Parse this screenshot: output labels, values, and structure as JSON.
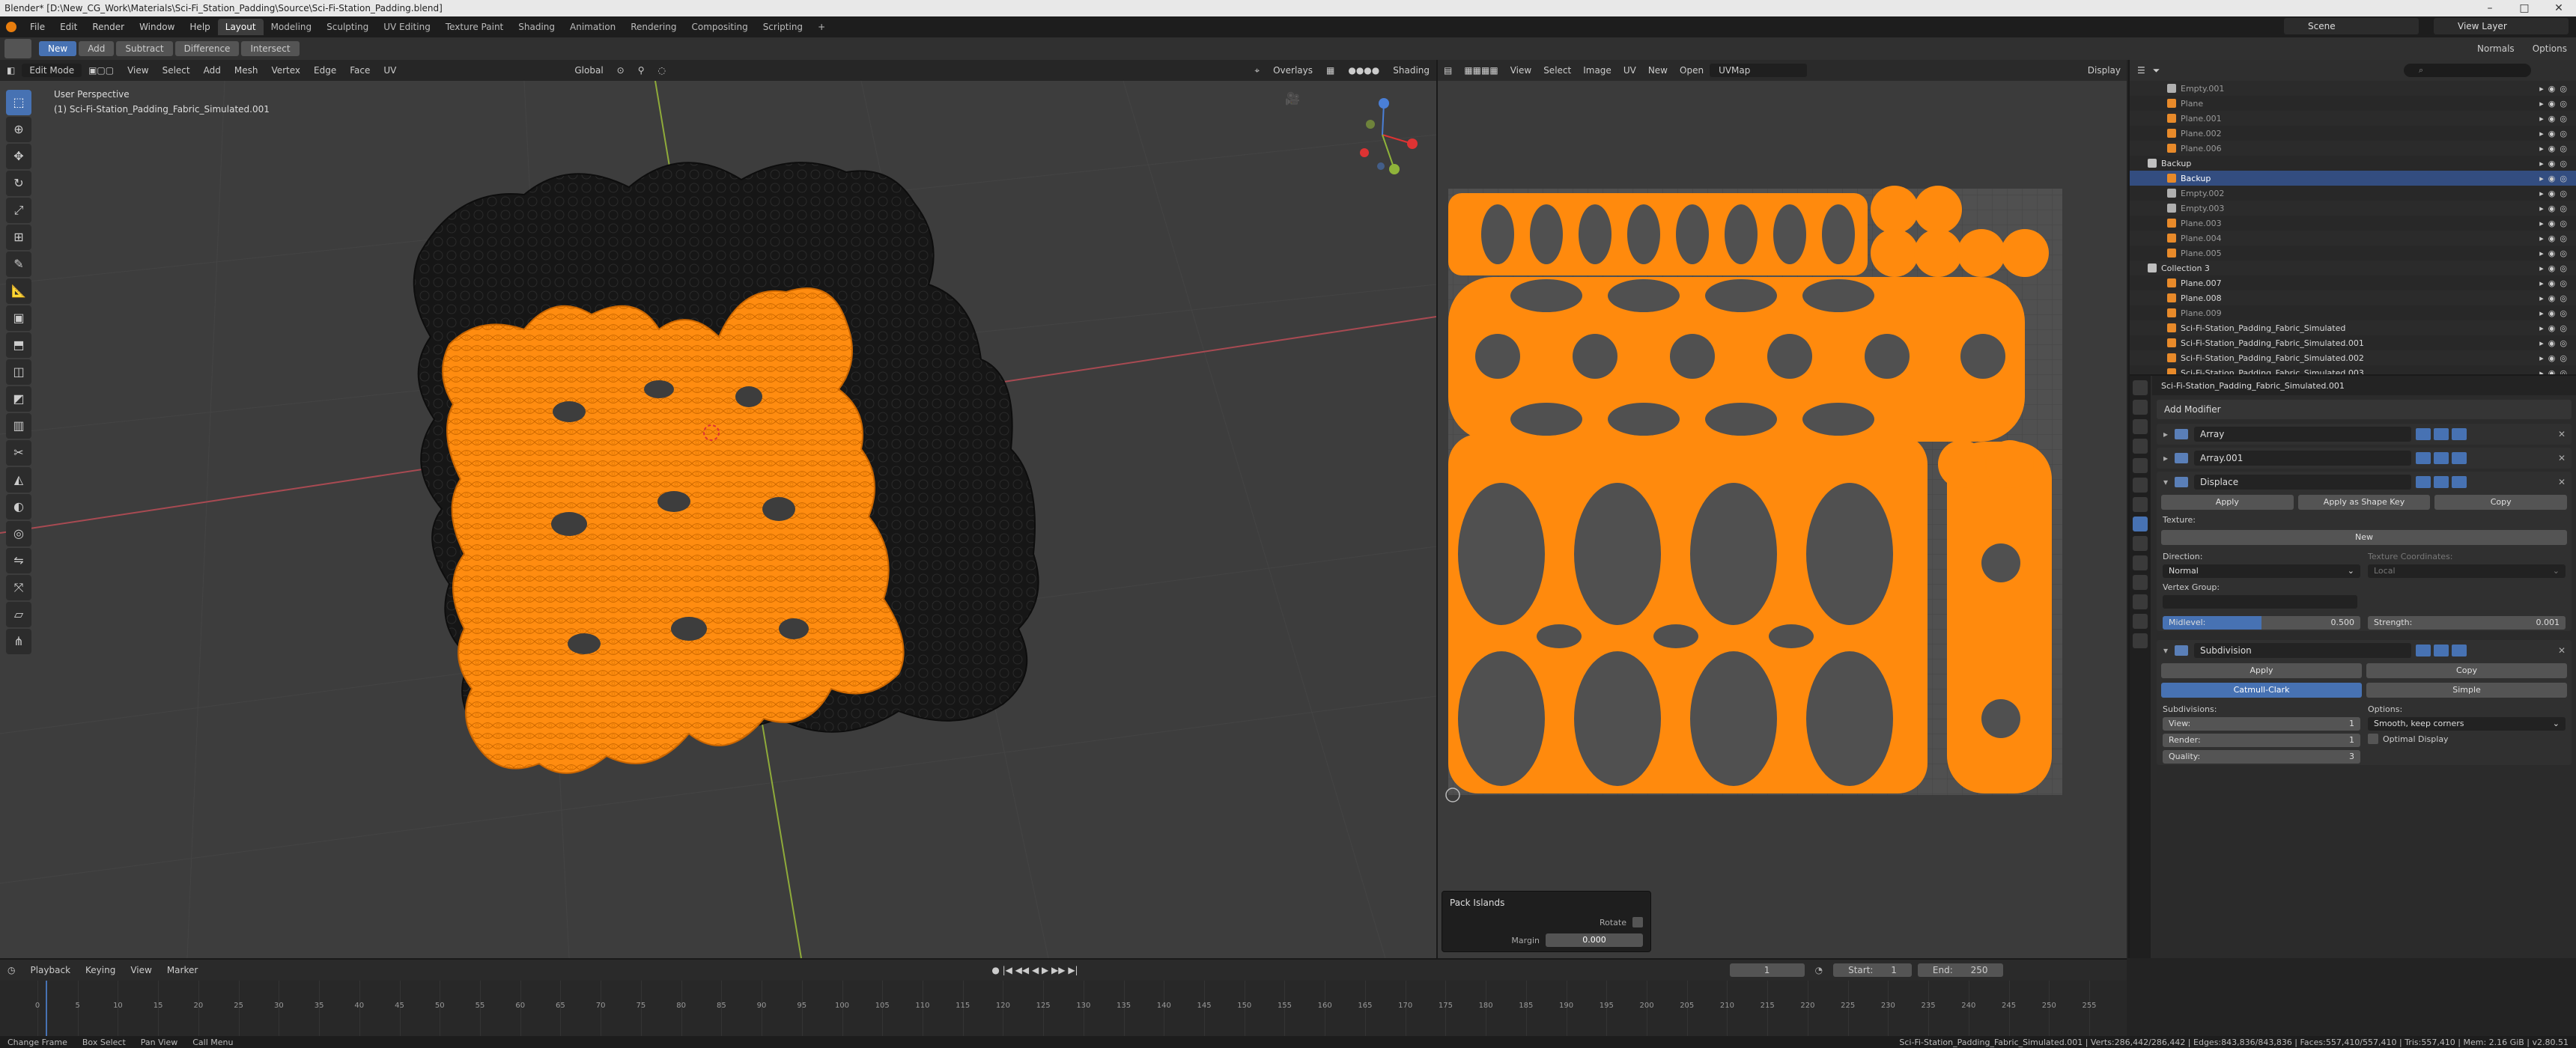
{
  "window": {
    "title": "Blender* [D:\\New_CG_Work\\Materials\\Sci-Fi_Station_Padding\\Source\\Sci-Fi-Station_Padding.blend]",
    "controls": [
      "–",
      "□",
      "✕"
    ]
  },
  "menu": [
    "File",
    "Edit",
    "Render",
    "Window",
    "Help"
  ],
  "workspaces": [
    "Layout",
    "Modeling",
    "Sculpting",
    "UV Editing",
    "Texture Paint",
    "Shading",
    "Animation",
    "Rendering",
    "Compositing",
    "Scripting",
    "+"
  ],
  "scene": {
    "scene_name": "Scene",
    "view_layer": "View Layer"
  },
  "tool_header": {
    "buttons": [
      "New",
      "Add",
      "Subtract",
      "Difference",
      "Intersect"
    ],
    "right": [
      "Normals",
      "Options"
    ]
  },
  "viewport": {
    "mode": "Edit Mode",
    "menus": [
      "View",
      "Select",
      "Add",
      "Mesh",
      "Vertex",
      "Edge",
      "Face",
      "UV"
    ],
    "orientation": "Global",
    "overlays": "Overlays",
    "shading": "Shading",
    "info_line1": "User Perspective",
    "info_line2": "(1) Sci-Fi-Station_Padding_Fabric_Simulated.001"
  },
  "uv_editor": {
    "menus": [
      "View",
      "Select",
      "Image",
      "UV"
    ],
    "new_label": "New",
    "open_label": "Open",
    "uvmap": "UVMap",
    "display": "Display",
    "pack_panel": {
      "title": "Pack Islands",
      "rotate_label": "Rotate",
      "margin_label": "Margin",
      "margin_value": "0.000"
    }
  },
  "outliner": {
    "rows": [
      {
        "label": "Empty.001",
        "type": "empty",
        "dim": true
      },
      {
        "label": "Plane",
        "type": "mesh",
        "dim": true
      },
      {
        "label": "Plane.001",
        "type": "mesh",
        "dim": true
      },
      {
        "label": "Plane.002",
        "type": "mesh",
        "dim": true
      },
      {
        "label": "Plane.006",
        "type": "mesh",
        "dim": true
      },
      {
        "label": "Backup",
        "type": "collection",
        "dim": true
      },
      {
        "label": "Backup",
        "type": "mesh",
        "sel": true
      },
      {
        "label": "Empty.002",
        "type": "empty",
        "dim": true
      },
      {
        "label": "Empty.003",
        "type": "empty",
        "dim": true
      },
      {
        "label": "Plane.003",
        "type": "mesh",
        "dim": true
      },
      {
        "label": "Plane.004",
        "type": "mesh",
        "dim": true
      },
      {
        "label": "Plane.005",
        "type": "mesh",
        "dim": true
      },
      {
        "label": "Collection 3",
        "type": "collection",
        "dim": false
      },
      {
        "label": "Plane.007",
        "type": "mesh",
        "dim": false
      },
      {
        "label": "Plane.008",
        "type": "mesh",
        "dim": false
      },
      {
        "label": "Plane.009",
        "type": "mesh",
        "dim": true
      },
      {
        "label": "Sci-Fi-Station_Padding_Fabric_Simulated",
        "type": "mesh",
        "dim": false
      },
      {
        "label": "Sci-Fi-Station_Padding_Fabric_Simulated.001",
        "type": "mesh",
        "dim": false,
        "bright": true
      },
      {
        "label": "Sci-Fi-Station_Padding_Fabric_Simulated.002",
        "type": "mesh",
        "dim": false
      },
      {
        "label": "Sci-Fi-Station_Padding_Fabric_Simulated.003",
        "type": "mesh",
        "dim": false
      }
    ]
  },
  "properties": {
    "object": "Sci-Fi-Station_Padding_Fabric_Simulated.001",
    "add_modifier": "Add Modifier",
    "mods": {
      "array": "Array",
      "array001": "Array.001",
      "displace": "Displace",
      "subdivision": "Subdivision"
    },
    "displace": {
      "apply": "Apply",
      "apply_shape": "Apply as Shape Key",
      "copy": "Copy",
      "texture_label": "Texture:",
      "new": "New",
      "direction_label": "Direction:",
      "direction_value": "Normal",
      "texcoords_label": "Texture Coordinates:",
      "texcoords_value": "Local",
      "vgroup_label": "Vertex Group:",
      "midlevel_label": "Midlevel:",
      "midlevel_value": "0.500",
      "midlevel_fill": 0.5,
      "strength_label": "Strength:",
      "strength_value": "0.001"
    },
    "subdiv": {
      "apply": "Apply",
      "copy": "Copy",
      "catmull": "Catmull-Clark",
      "simple": "Simple",
      "subdivisions_label": "Subdivisions:",
      "view_label": "View:",
      "view_value": "1",
      "render_label": "Render:",
      "render_value": "1",
      "quality_label": "Quality:",
      "quality_value": "3",
      "options_label": "Options:",
      "uv_smooth": "Smooth, keep corners",
      "optimal": "Optimal Display"
    }
  },
  "timeline": {
    "menus": [
      "Playback",
      "Keying",
      "View",
      "Marker"
    ],
    "current": "1",
    "start_label": "Start:",
    "start": "1",
    "end_label": "End:",
    "end": "250",
    "ticks": [
      "0",
      "5",
      "10",
      "15",
      "20",
      "25",
      "30",
      "35",
      "40",
      "45",
      "50",
      "55",
      "60",
      "65",
      "70",
      "75",
      "80",
      "85",
      "90",
      "95",
      "100",
      "105",
      "110",
      "115",
      "120",
      "125",
      "130",
      "135",
      "140",
      "145",
      "150",
      "155",
      "160",
      "165",
      "170",
      "175",
      "180",
      "185",
      "190",
      "195",
      "200",
      "205",
      "210",
      "215",
      "220",
      "225",
      "230",
      "235",
      "240",
      "245",
      "250",
      "255"
    ],
    "playhead": "1"
  },
  "statusbar": {
    "left": [
      "Change Frame",
      "Box Select",
      "Pan View",
      "Call Menu"
    ],
    "stats": "Sci-Fi-Station_Padding_Fabric_Simulated.001 | Verts:286,442/286,442 | Edges:843,836/843,836 | Faces:557,410/557,410 | Tris:557,410 | Mem: 2.16 GiB | v2.80.51"
  },
  "colors": {
    "orange": "#ff8a0d",
    "selection": "#4772b3",
    "bg": "#3d3d3d"
  }
}
